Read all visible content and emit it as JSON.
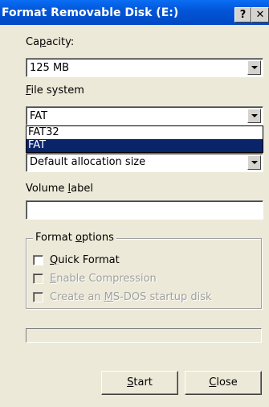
{
  "window": {
    "title": "Format Removable Disk (E:)",
    "help_label": "?",
    "close_label": "✕"
  },
  "capacity": {
    "label_pre": "Ca",
    "label_mnemonic": "p",
    "label_post": "acity:",
    "value": "125 MB"
  },
  "file_system": {
    "label_mnemonic": "F",
    "label_post": "ile system",
    "value": "FAT",
    "options": [
      "FAT32",
      "FAT"
    ],
    "selected_option": "FAT"
  },
  "allocation": {
    "value": "Default allocation size"
  },
  "volume_label": {
    "label_pre": "Volume ",
    "label_mnemonic": "l",
    "label_post": "abel",
    "value": ""
  },
  "format_options": {
    "legend_pre": "Format ",
    "legend_mnemonic": "o",
    "legend_post": "ptions",
    "quick_format": {
      "label_mnemonic": "Q",
      "label_post": "uick Format",
      "checked": false,
      "enabled": true
    },
    "compression": {
      "label_mnemonic": "E",
      "label_post": "nable Compression",
      "checked": false,
      "enabled": false
    },
    "msdos_startup": {
      "label_pre": "Create an ",
      "label_mnemonic": "M",
      "label_post": "S-DOS startup disk",
      "checked": false,
      "enabled": false
    }
  },
  "progress": {
    "value": 0
  },
  "buttons": {
    "start_mnemonic": "S",
    "start_post": "tart",
    "close_mnemonic": "C",
    "close_post": "lose"
  },
  "colors": {
    "title_bar": "#0256d9",
    "dialog_bg": "#ece9d8",
    "selection": "#0a246a"
  }
}
